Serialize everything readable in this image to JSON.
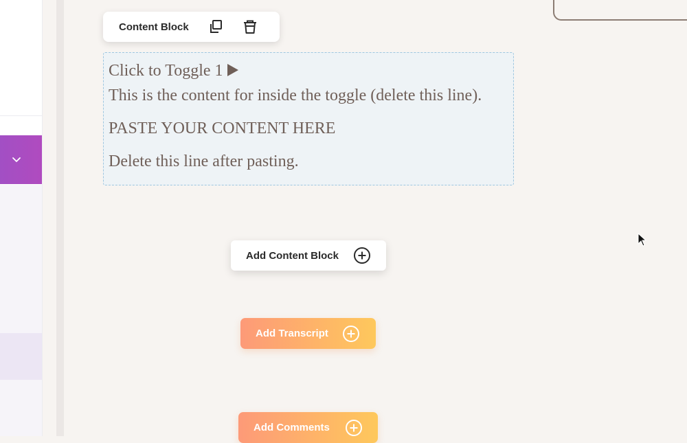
{
  "toolbar": {
    "label": "Content Block",
    "icons": [
      "duplicate-icon",
      "trash-icon"
    ]
  },
  "toggle": {
    "title": "Click to Toggle 1",
    "lines": [
      "This is the content for inside the toggle (delete this line).",
      "PASTE YOUR CONTENT HERE",
      "Delete this line after pasting."
    ]
  },
  "buttons": {
    "add_content_block": "Add Content Block",
    "add_transcript": "Add Transcript",
    "add_comments": "Add Comments"
  },
  "colors": {
    "sidebar_active": "#a24fc4",
    "button_gradient_start": "#fd9a78",
    "button_gradient_end": "#fec85c",
    "text_serif": "#6f5f58"
  }
}
